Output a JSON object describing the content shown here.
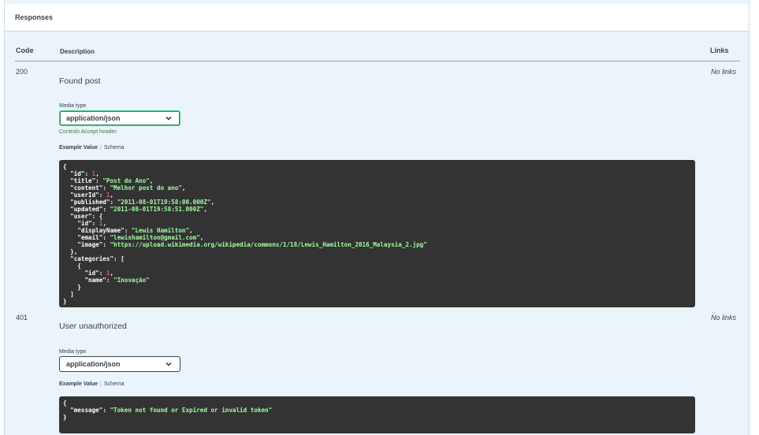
{
  "responses": {
    "title": "Responses",
    "headers": {
      "code": "Code",
      "description": "Description",
      "links": "Links"
    },
    "items": [
      {
        "code": "200",
        "description": "Found post",
        "links": "No links",
        "media_type_label": "Media type",
        "media_type": "application/json",
        "controls_note": "Controls Accept header.",
        "tab_example": "Example Value",
        "tab_schema": "Schema",
        "example": {
          "id": 1,
          "title": "Post do Ano",
          "content": "Melhor post do ano",
          "userId": 1,
          "published": "2011-08-01T19:58:00.000Z",
          "updated": "2011-08-01T19:58:51.000Z",
          "user": {
            "id": 1,
            "displayName": "Lewis Hamilton",
            "email": "lewishamilton@gmail.com",
            "image": "https://upload.wikimedia.org/wikipedia/commons/1/18/Lewis_Hamilton_2016_Malaysia_2.jpg"
          },
          "categories": [
            {
              "id": 1,
              "name": "Inovação"
            }
          ]
        }
      },
      {
        "code": "401",
        "description": "User unauthorized",
        "links": "No links",
        "media_type_label": "Media type",
        "media_type": "application/json",
        "tab_example": "Example Value",
        "tab_schema": "Schema",
        "example": {
          "message": "Token not found or Expired or invalid token"
        }
      }
    ]
  },
  "colors": {
    "panel_bg": "#ebf3fb",
    "code_bg": "#333333",
    "string": "#a2fca2",
    "number": "#d36363",
    "accent_green": "#49cc90"
  }
}
